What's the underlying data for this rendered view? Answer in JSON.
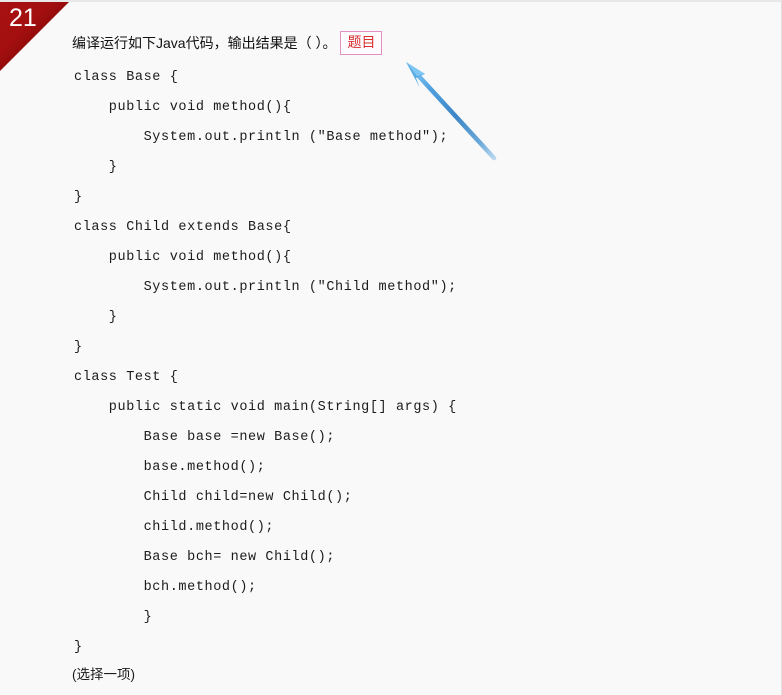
{
  "question": {
    "number": "21",
    "prompt": "编译运行如下Java代码，输出结果是（  ）。",
    "tag_label": "题目",
    "choose_note": "(选择一项)"
  },
  "code": {
    "language": "Java",
    "lines": [
      "class Base {",
      "    public void method(){",
      "        System.out.println (\"Base method\");",
      "    }",
      "}",
      "class Child extends Base{",
      "    public void method(){",
      "        System.out.println (\"Child method\");",
      "    }",
      "}",
      "class Test {",
      "    public static void main(String[] args) {",
      "        Base base =new Base();",
      "        base.method();",
      "        Child child=new Child();",
      "        child.method();",
      "        Base bch= new Child();",
      "        bch.method();",
      "        }",
      "}"
    ]
  },
  "annotation": {
    "arrow_color_light": "#63b3ec",
    "arrow_color_dark": "#2f7fc4",
    "tag_border_color": "#e48fc4",
    "tag_text_color": "#d83030"
  },
  "theme": {
    "ribbon_color": "#8b0b0b",
    "page_background": "#f9f9f9",
    "text_color": "#1b1b1b"
  }
}
